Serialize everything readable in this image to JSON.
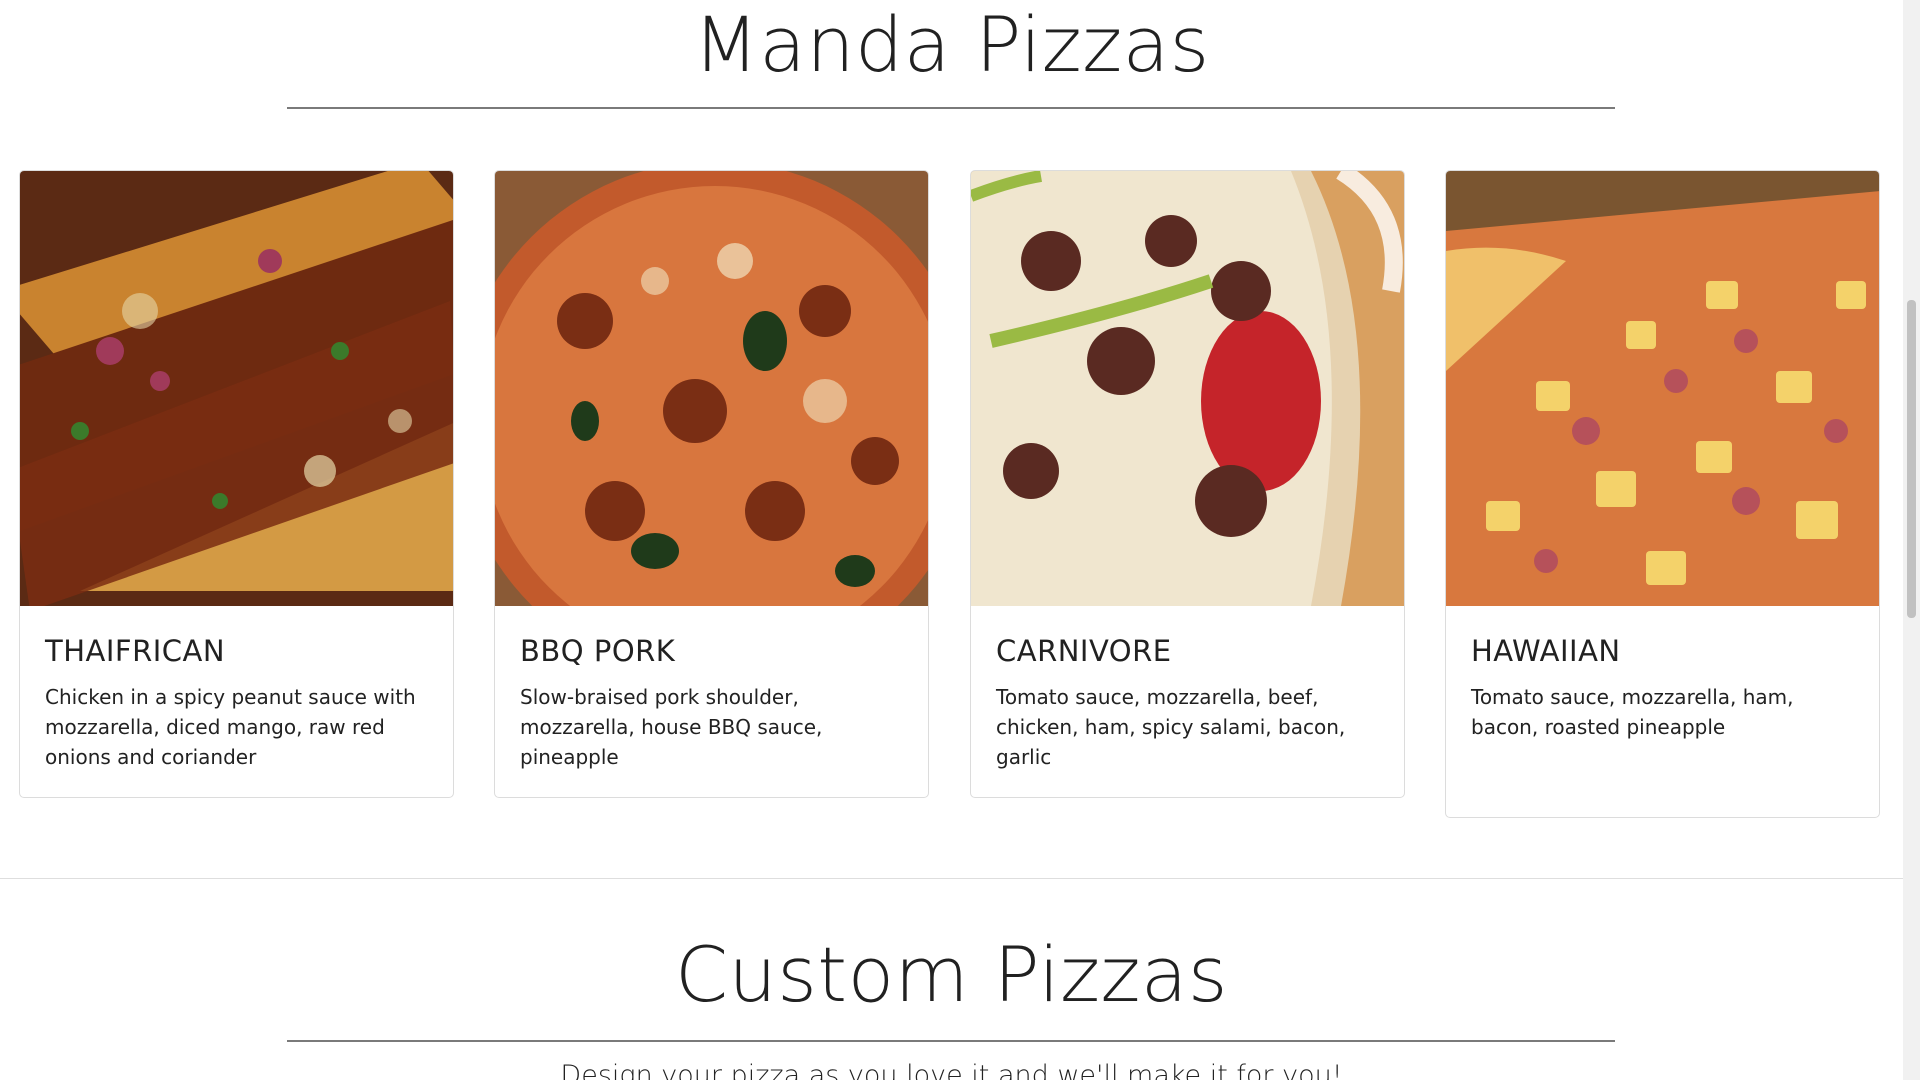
{
  "sections": {
    "manda": {
      "title": "Manda Pizzas"
    },
    "custom": {
      "title": "Custom Pizzas",
      "subtitle": "Design your pizza as you love it and we'll make it for you!"
    }
  },
  "pizzas": [
    {
      "name": "THAIFRICAN",
      "description": "Chicken in a spicy peanut sauce with mozzarella, diced mango, raw red onions and coriander"
    },
    {
      "name": "BBQ PORK",
      "description": "Slow-braised pork shoulder, mozzarella, house BBQ sauce, pineapple"
    },
    {
      "name": "CARNIVORE",
      "description": "Tomato sauce, mozzarella, beef, chicken, ham, spicy salami, bacon, garlic"
    },
    {
      "name": "HAWAIIAN",
      "description": "Tomato sauce, mozzarella, ham, bacon, roasted pineapple"
    }
  ],
  "colors": {
    "text": "#212121",
    "rule": "#7a7a7a",
    "card_border": "#dcdcdc"
  }
}
